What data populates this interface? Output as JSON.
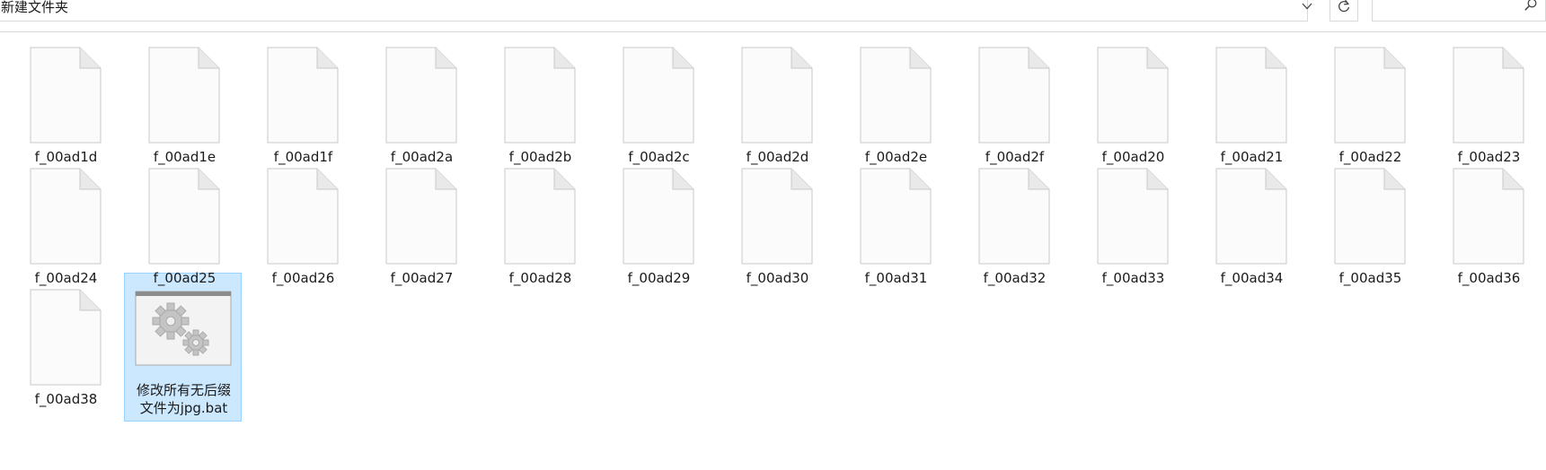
{
  "address_bar": {
    "path": "新建文件夹"
  },
  "search": {
    "placeholder": ""
  },
  "icons": {
    "dropdown": "chevron-down-icon",
    "refresh": "refresh-icon",
    "search": "search-icon",
    "file": "blank-file-icon",
    "batch": "batch-file-gears-icon"
  },
  "colors": {
    "selection_bg": "#cce8ff",
    "selection_border": "#99d1ff"
  },
  "files": [
    {
      "name": "f_00ad1d"
    },
    {
      "name": "f_00ad1e"
    },
    {
      "name": "f_00ad1f"
    },
    {
      "name": "f_00ad2a"
    },
    {
      "name": "f_00ad2b"
    },
    {
      "name": "f_00ad2c"
    },
    {
      "name": "f_00ad2d"
    },
    {
      "name": "f_00ad2e"
    },
    {
      "name": "f_00ad2f"
    },
    {
      "name": "f_00ad20"
    },
    {
      "name": "f_00ad21"
    },
    {
      "name": "f_00ad22"
    },
    {
      "name": "f_00ad23"
    },
    {
      "name": "f_00ad24"
    },
    {
      "name": "f_00ad25"
    },
    {
      "name": "f_00ad26"
    },
    {
      "name": "f_00ad27"
    },
    {
      "name": "f_00ad28"
    },
    {
      "name": "f_00ad29"
    },
    {
      "name": "f_00ad30"
    },
    {
      "name": "f_00ad31"
    },
    {
      "name": "f_00ad32"
    },
    {
      "name": "f_00ad33"
    },
    {
      "name": "f_00ad34"
    },
    {
      "name": "f_00ad35"
    },
    {
      "name": "f_00ad36"
    },
    {
      "name": "f_00ad38"
    }
  ],
  "batch_file": {
    "name_line1": "修改所有无后缀",
    "name_line2": "文件为jpg.bat",
    "selected": true
  }
}
